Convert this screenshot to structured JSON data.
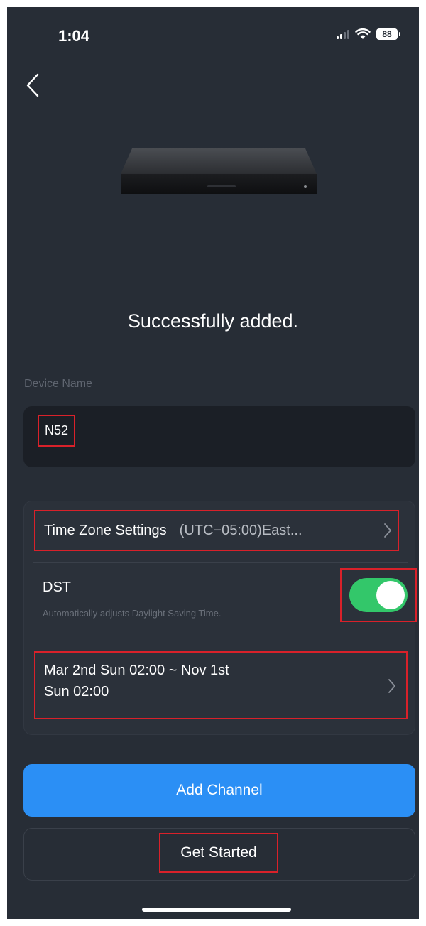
{
  "status_bar": {
    "time": "1:04",
    "battery": "88",
    "icons": [
      "signal-icon",
      "wifi-icon",
      "battery-icon"
    ]
  },
  "nav": {
    "back_icon": "chevron-left-icon"
  },
  "device": {
    "image_icon": "nvr-device-image"
  },
  "title": "Successfully added.",
  "device_name": {
    "label": "Device Name",
    "value": "N52"
  },
  "settings": {
    "time_zone": {
      "label": "Time Zone Settings",
      "value": "(UTC−05:00)East...",
      "icon": "chevron-right-icon"
    },
    "dst": {
      "label": "DST",
      "description": "Automatically adjusts Daylight Saving Time.",
      "enabled": true
    },
    "dst_range": {
      "line1": "Mar 2nd Sun 02:00 ~ Nov 1st",
      "line2": "Sun 02:00",
      "icon": "chevron-right-icon"
    }
  },
  "buttons": {
    "add_channel": "Add Channel",
    "get_started": "Get Started"
  },
  "colors": {
    "background": "#272d36",
    "primary": "#2b8ff5",
    "toggle_on": "#33c76a",
    "highlight": "#d9212a"
  }
}
